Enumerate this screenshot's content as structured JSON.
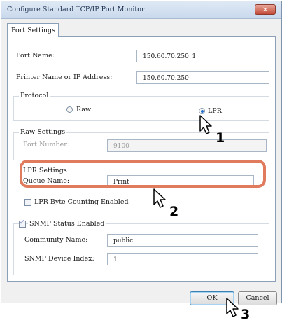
{
  "window": {
    "title": "Configure Standard TCP/IP Port Monitor",
    "close_glyph": "✕"
  },
  "tab": {
    "label": "Port Settings"
  },
  "port_name": {
    "label": "Port Name:",
    "value": "150.60.70.250_1"
  },
  "printer_name": {
    "label": "Printer Name or IP Address:",
    "value": "150.60.70.250"
  },
  "protocol": {
    "group_label": "Protocol",
    "raw_label": "Raw",
    "raw_selected": false,
    "lpr_label": "LPR",
    "lpr_selected": true
  },
  "raw_settings": {
    "group_label": "Raw Settings",
    "port_number_label": "Port Number:",
    "port_number_value": "9100"
  },
  "lpr_settings": {
    "group_label": "LPR Settings",
    "queue_name_label": "Queue Name:",
    "queue_name_value": "Print",
    "byte_counting_label": "LPR Byte Counting Enabled",
    "byte_counting_checked": false
  },
  "snmp": {
    "enabled_label": "SNMP Status Enabled",
    "enabled_checked": true,
    "community_label": "Community Name:",
    "community_value": "public",
    "device_index_label": "SNMP Device Index:",
    "device_index_value": "1"
  },
  "buttons": {
    "ok": "OK",
    "cancel": "Cancel"
  },
  "annotations": {
    "step1": "1",
    "step2": "2",
    "step3": "3"
  },
  "colors": {
    "highlight": "#e07b5e",
    "radio_fill": "#1e6fc9"
  },
  "icons": [
    "close-icon",
    "arrow-cursor-icon"
  ]
}
